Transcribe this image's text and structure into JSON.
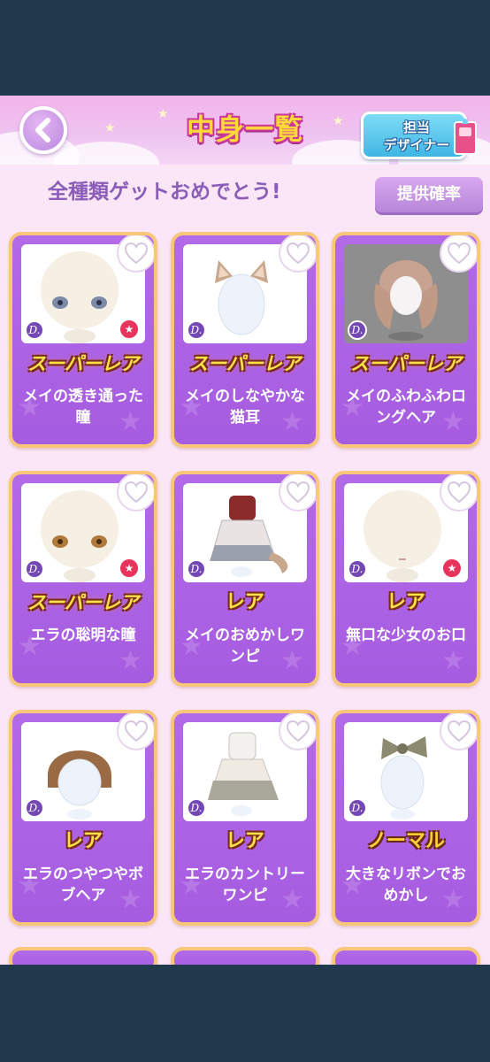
{
  "header": {
    "title": "中身一覧",
    "designer_line1": "担当",
    "designer_line2": "デザイナー"
  },
  "summary": {
    "congrats": "全種類ゲットおめでとう!",
    "rates_button": "提供確率"
  },
  "rarity_labels": {
    "super_rare": "スーパーレア",
    "rare": "レア",
    "normal": "ノーマル"
  },
  "items": [
    {
      "name": "メイの透き通った瞳",
      "rarity": "スーパーレア",
      "favorited": true
    },
    {
      "name": "メイのしなやかな猫耳",
      "rarity": "スーパーレア",
      "favorited": false
    },
    {
      "name": "メイのふわふわロングヘア",
      "rarity": "スーパーレア",
      "favorited": false
    },
    {
      "name": "エラの聡明な瞳",
      "rarity": "スーパーレア",
      "favorited": true
    },
    {
      "name": "メイのおめかしワンピ",
      "rarity": "レア",
      "favorited": false
    },
    {
      "name": "無口な少女のお口",
      "rarity": "レア",
      "favorited": true
    },
    {
      "name": "エラのつやつやボブヘア",
      "rarity": "レア",
      "favorited": false
    },
    {
      "name": "エラのカントリーワンピ",
      "rarity": "レア",
      "favorited": false
    },
    {
      "name": "大きなリボンでおめかし",
      "rarity": "ノーマル",
      "favorited": false
    }
  ],
  "badge": {
    "designer_mark": "D."
  },
  "colors": {
    "background": "#fbe6f7",
    "card_border": "#f8c779",
    "card_fill": "#a65ce0",
    "title_gold": "#ffd83a",
    "accent_blue": "#3fb6e4",
    "status_bar": "#21394c"
  },
  "icons": {
    "back": "chevron-left-icon",
    "heart": "heart-icon",
    "favorite": "star-icon",
    "designer": "designer-book-icon"
  }
}
